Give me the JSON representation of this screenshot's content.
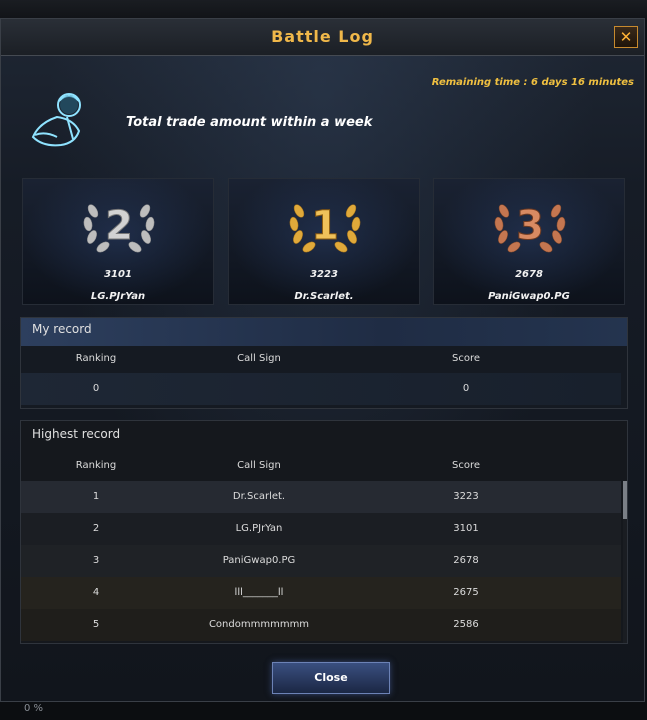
{
  "window": {
    "title": "Battle Log",
    "close_symbol": "✕",
    "remaining_time": "Remaining time : 6 days 16 minutes",
    "heading": "Total trade amount within a week"
  },
  "podium": [
    {
      "rank": "2",
      "score": "3101",
      "name": "LG.PJrYan",
      "color": "#c8c8c8"
    },
    {
      "rank": "1",
      "score": "3223",
      "name": "Dr.Scarlet.",
      "color": "#e3b042"
    },
    {
      "rank": "3",
      "score": "2678",
      "name": "PaniGwap0.PG",
      "color": "#c87a55"
    }
  ],
  "my_record": {
    "title": "My record",
    "headers": {
      "ranking": "Ranking",
      "call_sign": "Call Sign",
      "score": "Score"
    },
    "row": {
      "ranking": "0",
      "call_sign": "",
      "score": "0"
    }
  },
  "highest_record": {
    "title": "Highest record",
    "headers": {
      "ranking": "Ranking",
      "call_sign": "Call Sign",
      "score": "Score"
    },
    "rows": [
      {
        "ranking": "1",
        "call_sign": "Dr.Scarlet.",
        "score": "3223"
      },
      {
        "ranking": "2",
        "call_sign": "LG.PJrYan",
        "score": "3101"
      },
      {
        "ranking": "3",
        "call_sign": "PaniGwap0.PG",
        "score": "2678"
      },
      {
        "ranking": "4",
        "call_sign": "lll_______ll",
        "score": "2675"
      },
      {
        "ranking": "5",
        "call_sign": "Condommmmmmm",
        "score": "2586"
      }
    ]
  },
  "footer": {
    "close_label": "Close",
    "progress_text": "0 %"
  }
}
